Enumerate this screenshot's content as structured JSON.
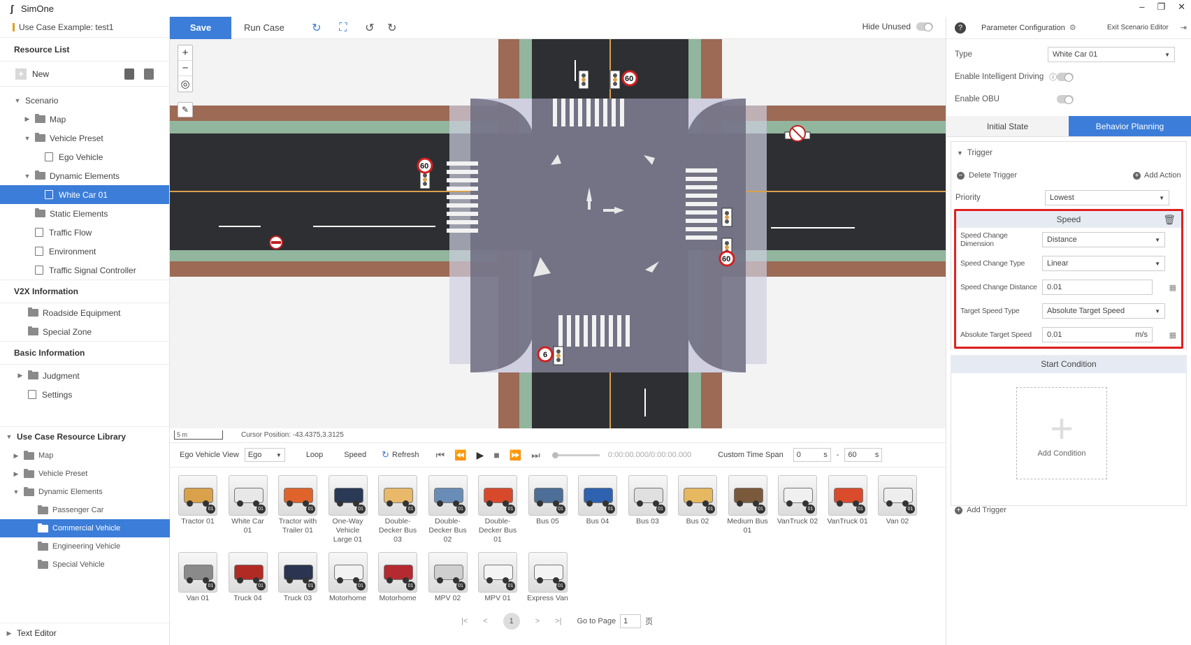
{
  "app": {
    "name": "SimOne"
  },
  "window": {
    "minimize": "–",
    "restore": "❐",
    "close": "✕"
  },
  "left": {
    "use_case": "Use Case Example: test1",
    "resource_list_title": "Resource List",
    "new_label": "New",
    "tree": [
      {
        "label": "Scenario",
        "caret": "▼",
        "level": 0,
        "icon": "none"
      },
      {
        "label": "Map",
        "caret": "▶",
        "level": 1,
        "icon": "folder"
      },
      {
        "label": "Vehicle Preset",
        "caret": "▼",
        "level": 1,
        "icon": "folder-open"
      },
      {
        "label": "Ego Vehicle",
        "caret": "",
        "level": 2,
        "icon": "car"
      },
      {
        "label": "Dynamic Elements",
        "caret": "▼",
        "level": 1,
        "icon": "folder-open"
      },
      {
        "label": "White Car 01",
        "caret": "",
        "level": 2,
        "icon": "doc",
        "selected": true
      },
      {
        "label": "Static Elements",
        "caret": "",
        "level": 1,
        "icon": "folder"
      },
      {
        "label": "Traffic Flow",
        "caret": "",
        "level": 1,
        "icon": "doc"
      },
      {
        "label": "Environment",
        "caret": "",
        "level": 1,
        "icon": "env"
      },
      {
        "label": "Traffic Signal Controller",
        "caret": "",
        "level": 1,
        "icon": "gear"
      }
    ],
    "v2x_title": "V2X Information",
    "v2x_items": [
      "Roadside Equipment",
      "Special Zone"
    ],
    "basic_title": "Basic Information",
    "basic_items": [
      {
        "label": "Judgment",
        "caret": "▶",
        "icon": "folder"
      },
      {
        "label": "Settings",
        "caret": "",
        "icon": "doc"
      }
    ],
    "library_title": "Use Case Resource Library",
    "library_items": [
      {
        "label": "Map",
        "caret": "▶",
        "level": 1
      },
      {
        "label": "Vehicle Preset",
        "caret": "▶",
        "level": 1
      },
      {
        "label": "Dynamic Elements",
        "caret": "▼",
        "level": 1
      },
      {
        "label": "Passenger Car",
        "caret": "",
        "level": 2
      },
      {
        "label": "Commercial Vehicle",
        "caret": "",
        "level": 2,
        "selected": true
      },
      {
        "label": "Engineering Vehicle",
        "caret": "",
        "level": 2
      },
      {
        "label": "Special Vehicle",
        "caret": "",
        "level": 2
      }
    ],
    "text_editor": "Text Editor"
  },
  "toolbar": {
    "save": "Save",
    "run_case": "Run Case",
    "hide_unused": "Hide Unused"
  },
  "map": {
    "zoom_in": "+",
    "zoom_out": "−",
    "locate": "◎",
    "ruler": "📏",
    "scale": "5 m",
    "cursor_position": "Cursor Position: -43.4375,3.3125",
    "speed_signs": [
      "60",
      "60",
      "60",
      "6"
    ]
  },
  "playback": {
    "ego_view_label": "Ego Vehicle View",
    "ego_view_value": "Ego",
    "loop": "Loop",
    "speed": "Speed",
    "refresh": "Refresh",
    "time": "0:00:00.000/0:00:00.000",
    "custom_span": "Custom Time Span",
    "span_start": "0",
    "span_end": "60",
    "unit": "s",
    "dash": "-"
  },
  "vehicles": [
    {
      "name": "Tractor 01",
      "color": "#d9a24a"
    },
    {
      "name": "White Car 01",
      "color": "#e8e8e8"
    },
    {
      "name": "Tractor with Trailer 01",
      "color": "#e0632b"
    },
    {
      "name": "One-Way Vehicle Large 01",
      "color": "#2a3a56"
    },
    {
      "name": "Double-Decker Bus 03",
      "color": "#e9b96a"
    },
    {
      "name": "Double-Decker Bus 02",
      "color": "#6a8db8"
    },
    {
      "name": "Double-Decker Bus 01",
      "color": "#d8482b"
    },
    {
      "name": "Bus 05",
      "color": "#4d6e96"
    },
    {
      "name": "Bus 04",
      "color": "#2e62b0"
    },
    {
      "name": "Bus 03",
      "color": "#e0e0e0"
    },
    {
      "name": "Bus 02",
      "color": "#e6b860"
    },
    {
      "name": "Medium Bus 01",
      "color": "#7a5a3a"
    },
    {
      "name": "VanTruck 02",
      "color": "#f0f0f0"
    },
    {
      "name": "VanTruck 01",
      "color": "#d94b2b"
    },
    {
      "name": "Van 02",
      "color": "#eeeeee"
    },
    {
      "name": "Van 01",
      "color": "#8a8a8a"
    },
    {
      "name": "Truck 04",
      "color": "#b22a24"
    },
    {
      "name": "Truck 03",
      "color": "#2b3450"
    },
    {
      "name": "Motorhome",
      "color": "#f2f2f2"
    },
    {
      "name": "Motorhome",
      "color": "#b52a30"
    },
    {
      "name": "MPV 02",
      "color": "#cfcfcf"
    },
    {
      "name": "MPV 01",
      "color": "#f4f4f4"
    },
    {
      "name": "Express Van",
      "color": "#f4f4f4"
    }
  ],
  "vehicle_badge": "01",
  "pager": {
    "first": "|<",
    "prev": "<",
    "current": "1",
    "next": ">",
    "last": ">|",
    "goto_label": "Go to Page",
    "goto_value": "1",
    "page_unit": "页"
  },
  "right": {
    "param_config": "Parameter Configuration",
    "exit_editor": "Exit Scenario Editor",
    "type_label": "Type",
    "type_value": "White Car 01",
    "intelligent_driving": "Enable Intelligent Driving",
    "enable_obu": "Enable OBU",
    "tab_initial": "Initial State",
    "tab_behavior": "Behavior Planning",
    "trigger": "Trigger",
    "delete_trigger": "Delete Trigger",
    "add_action": "Add Action",
    "priority_label": "Priority",
    "priority_value": "Lowest",
    "speed_title": "Speed",
    "speed_fields": [
      {
        "label": "Speed Change Dimension",
        "value": "Distance",
        "kind": "select"
      },
      {
        "label": "Speed Change Type",
        "value": "Linear",
        "kind": "select"
      },
      {
        "label": "Speed Change Distance",
        "value": "0.01",
        "kind": "input"
      },
      {
        "label": "Target Speed Type",
        "value": "Absolute Target Speed",
        "kind": "select"
      },
      {
        "label": "Absolute Target Speed",
        "value": "0.01",
        "kind": "input",
        "unit": "m/s"
      }
    ],
    "start_condition": "Start Condition",
    "add_condition": "Add Condition",
    "add_trigger": "Add Trigger"
  },
  "colors": {
    "accent": "#3b7dd8",
    "highlight": "#e02020"
  }
}
